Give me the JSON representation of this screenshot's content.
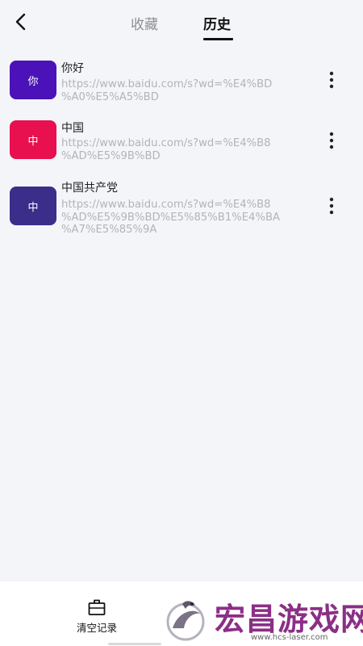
{
  "header": {
    "back_icon": "chevron-left-icon",
    "tabs": [
      {
        "label": "收藏",
        "active": false
      },
      {
        "label": "历史",
        "active": true
      }
    ]
  },
  "history": {
    "items": [
      {
        "badge": "你",
        "badge_color": "#4a12b8",
        "title": "你好",
        "url": "https://www.baidu.com/s?wd=%E4%BD\n%A0%E5%A5%BD"
      },
      {
        "badge": "中",
        "badge_color": "#e8104e",
        "title": "中国",
        "url": "https://www.baidu.com/s?wd=%E4%B8\n%AD%E5%9B%BD"
      },
      {
        "badge": "中",
        "badge_color": "#3a2e8a",
        "title": "中国共产党",
        "url": "https://www.baidu.com/s?wd=%E4%B8\n%AD%E5%9B%BD%E5%85%B1%E4%BA\n%A7%E5%85%9A"
      }
    ],
    "more_icon": "more-vertical-icon"
  },
  "bottom": {
    "clear_label": "清空记录",
    "clear_icon": "basket-icon"
  },
  "watermark": {
    "name": "宏昌游戏网",
    "site": "www.hcs-laser.com"
  },
  "colors": {
    "background": "#f4f5f9",
    "active_tab": "#111111",
    "inactive_tab": "#8e8e93",
    "url_text": "#b3b3b8",
    "watermark": "#8b2f86"
  }
}
